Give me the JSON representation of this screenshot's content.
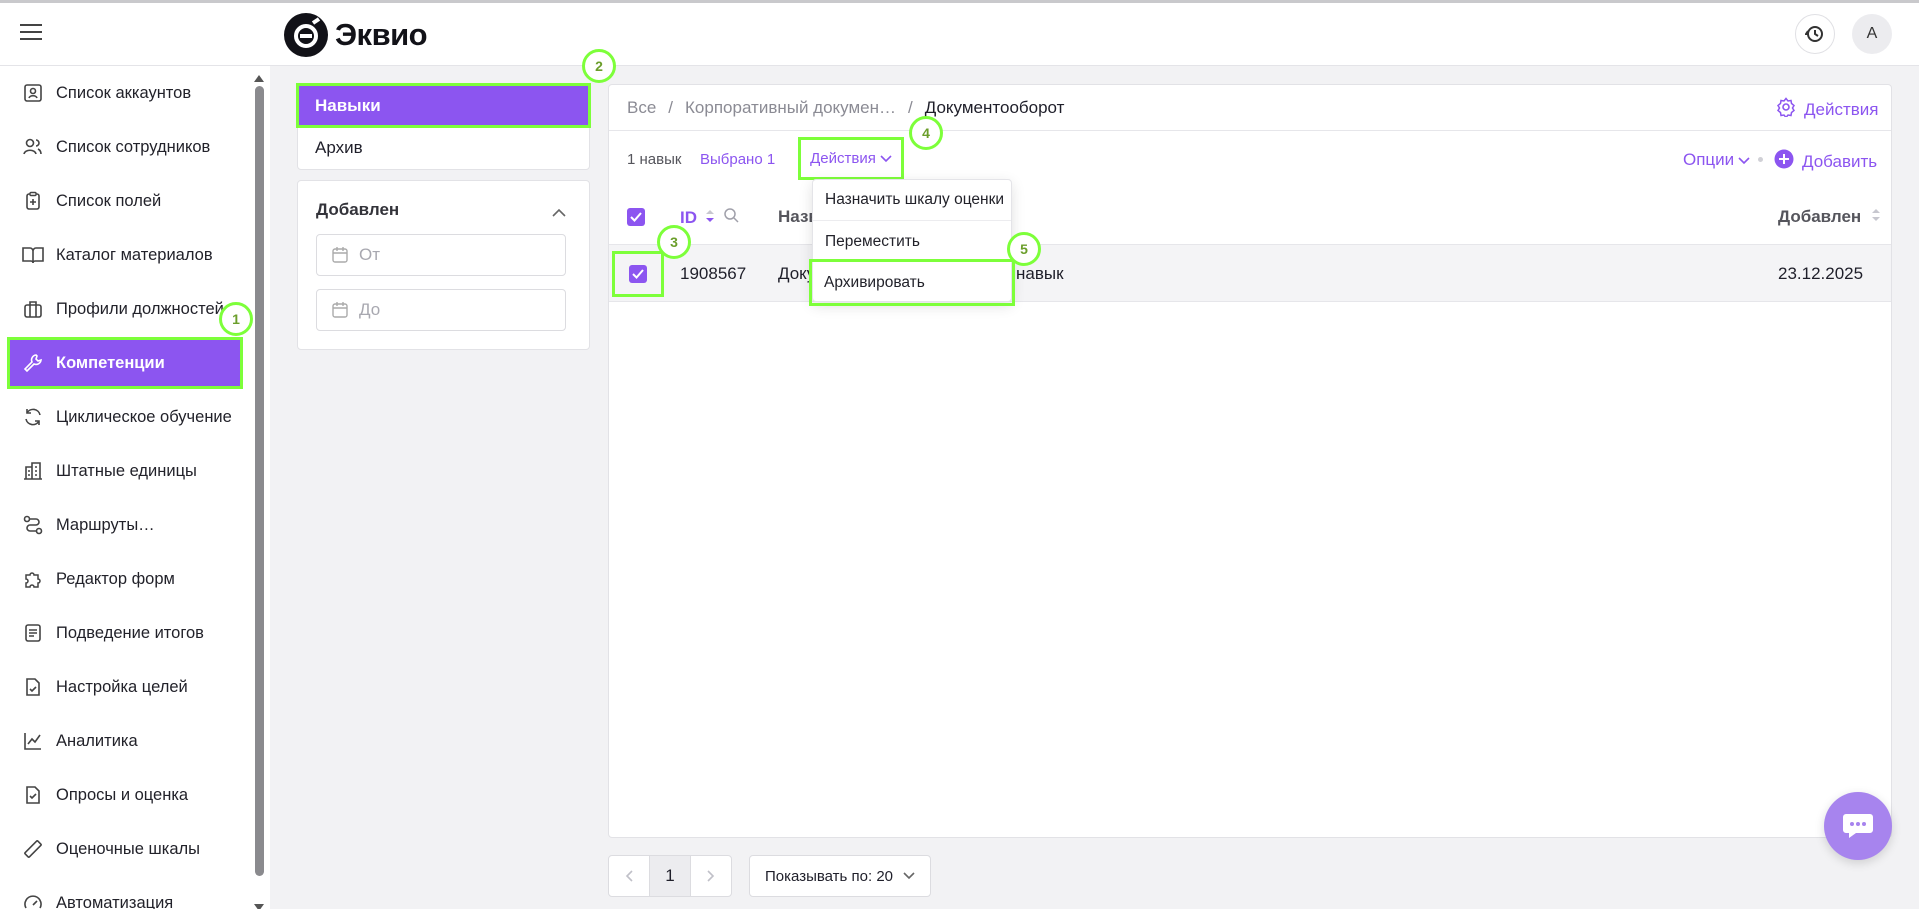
{
  "brand": {
    "logo_text": "Эквио"
  },
  "header": {
    "avatar_letter": "A"
  },
  "sidebar": {
    "items": [
      {
        "label": "Список аккаунтов",
        "icon": "account-list-icon"
      },
      {
        "label": "Список сотрудников",
        "icon": "users-icon"
      },
      {
        "label": "Список полей",
        "icon": "clipboard-plus-icon"
      },
      {
        "label": "Каталог материалов",
        "icon": "book-icon"
      },
      {
        "label": "Профили должностей",
        "icon": "briefcase-icon"
      },
      {
        "label": "Компетенции",
        "icon": "wrench-icon"
      },
      {
        "label": "Циклическое обучение",
        "icon": "refresh-icon"
      },
      {
        "label": "Штатные единицы",
        "icon": "building-icon"
      },
      {
        "label": "Маршруты…",
        "icon": "route-icon"
      },
      {
        "label": "Редактор форм",
        "icon": "puzzle-icon"
      },
      {
        "label": "Подведение итогов",
        "icon": "document-list-icon"
      },
      {
        "label": "Настройка целей",
        "icon": "file-check-icon"
      },
      {
        "label": "Аналитика",
        "icon": "chart-line-icon"
      },
      {
        "label": "Опросы и оценка",
        "icon": "survey-icon"
      },
      {
        "label": "Оценочные шкалы",
        "icon": "ruler-icon"
      },
      {
        "label": "Автоматизация",
        "icon": "gauge-icon"
      }
    ]
  },
  "left_panel": {
    "tabs": [
      "Навыки",
      "Архив"
    ],
    "filter_title": "Добавлен",
    "date_from_placeholder": "От",
    "date_to_placeholder": "До"
  },
  "breadcrumb": {
    "root": "Все",
    "middle": "Корпоративный докумен…",
    "current": "Документооборот",
    "sep": "/"
  },
  "main": {
    "actions_link": "Действия",
    "count": "1 навык",
    "selected": "Выбрано 1",
    "actions_dropdown": "Действия",
    "options": "Опции",
    "add": "Добавить",
    "menu": [
      "Назначить шкалу оценки",
      "Переместить",
      "Архивировать"
    ],
    "table": {
      "col_id": "ID",
      "col_name": "Назв",
      "col_added": "Добавлен",
      "rows": [
        {
          "id": "1908567",
          "name_start": "Доку",
          "name_end": "навык",
          "added": "23.12.2025"
        }
      ]
    }
  },
  "pagination": {
    "page": "1",
    "per_page": "Показывать по: 20"
  },
  "annotations": [
    "1",
    "2",
    "3",
    "4",
    "5"
  ],
  "colors": {
    "accent": "#8c55f0",
    "highlight": "#7dff3a"
  }
}
